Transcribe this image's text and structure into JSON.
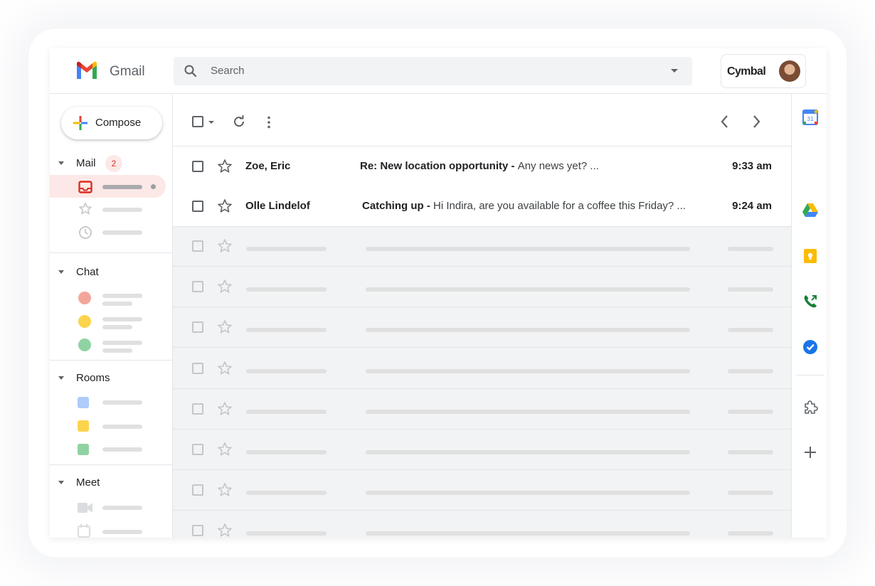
{
  "app": {
    "name": "Gmail"
  },
  "search": {
    "placeholder": "Search"
  },
  "account": {
    "name": "Cymbal"
  },
  "compose": {
    "label": "Compose"
  },
  "sidebar": {
    "mail": {
      "label": "Mail",
      "badge": "2"
    },
    "chat": {
      "label": "Chat"
    },
    "rooms": {
      "label": "Rooms"
    },
    "meet": {
      "label": "Meet"
    }
  },
  "emails": [
    {
      "sender": "Zoe, Eric",
      "subject": "Re: New location opportunity",
      "snippet": "Any news yet? ...",
      "time": "9:33 am"
    },
    {
      "sender": "Olle Lindelof",
      "subject": "Catching up",
      "snippet": "Hi Indira, are you available for a coffee this Friday? ...",
      "time": "9:24 am"
    }
  ],
  "separator": " - ",
  "colors": {
    "accent_red": "#d93025",
    "chat_dots": [
      "#f28b82",
      "#fdd663",
      "#81c995"
    ],
    "room_squares": [
      "#aecbfa",
      "#fdd663",
      "#81c995"
    ]
  },
  "icons": {
    "rail": [
      "calendar-icon",
      "drive-icon",
      "keep-icon",
      "voice-icon",
      "tasks-icon",
      "addons-icon",
      "add-icon",
      "expand-icon"
    ]
  }
}
